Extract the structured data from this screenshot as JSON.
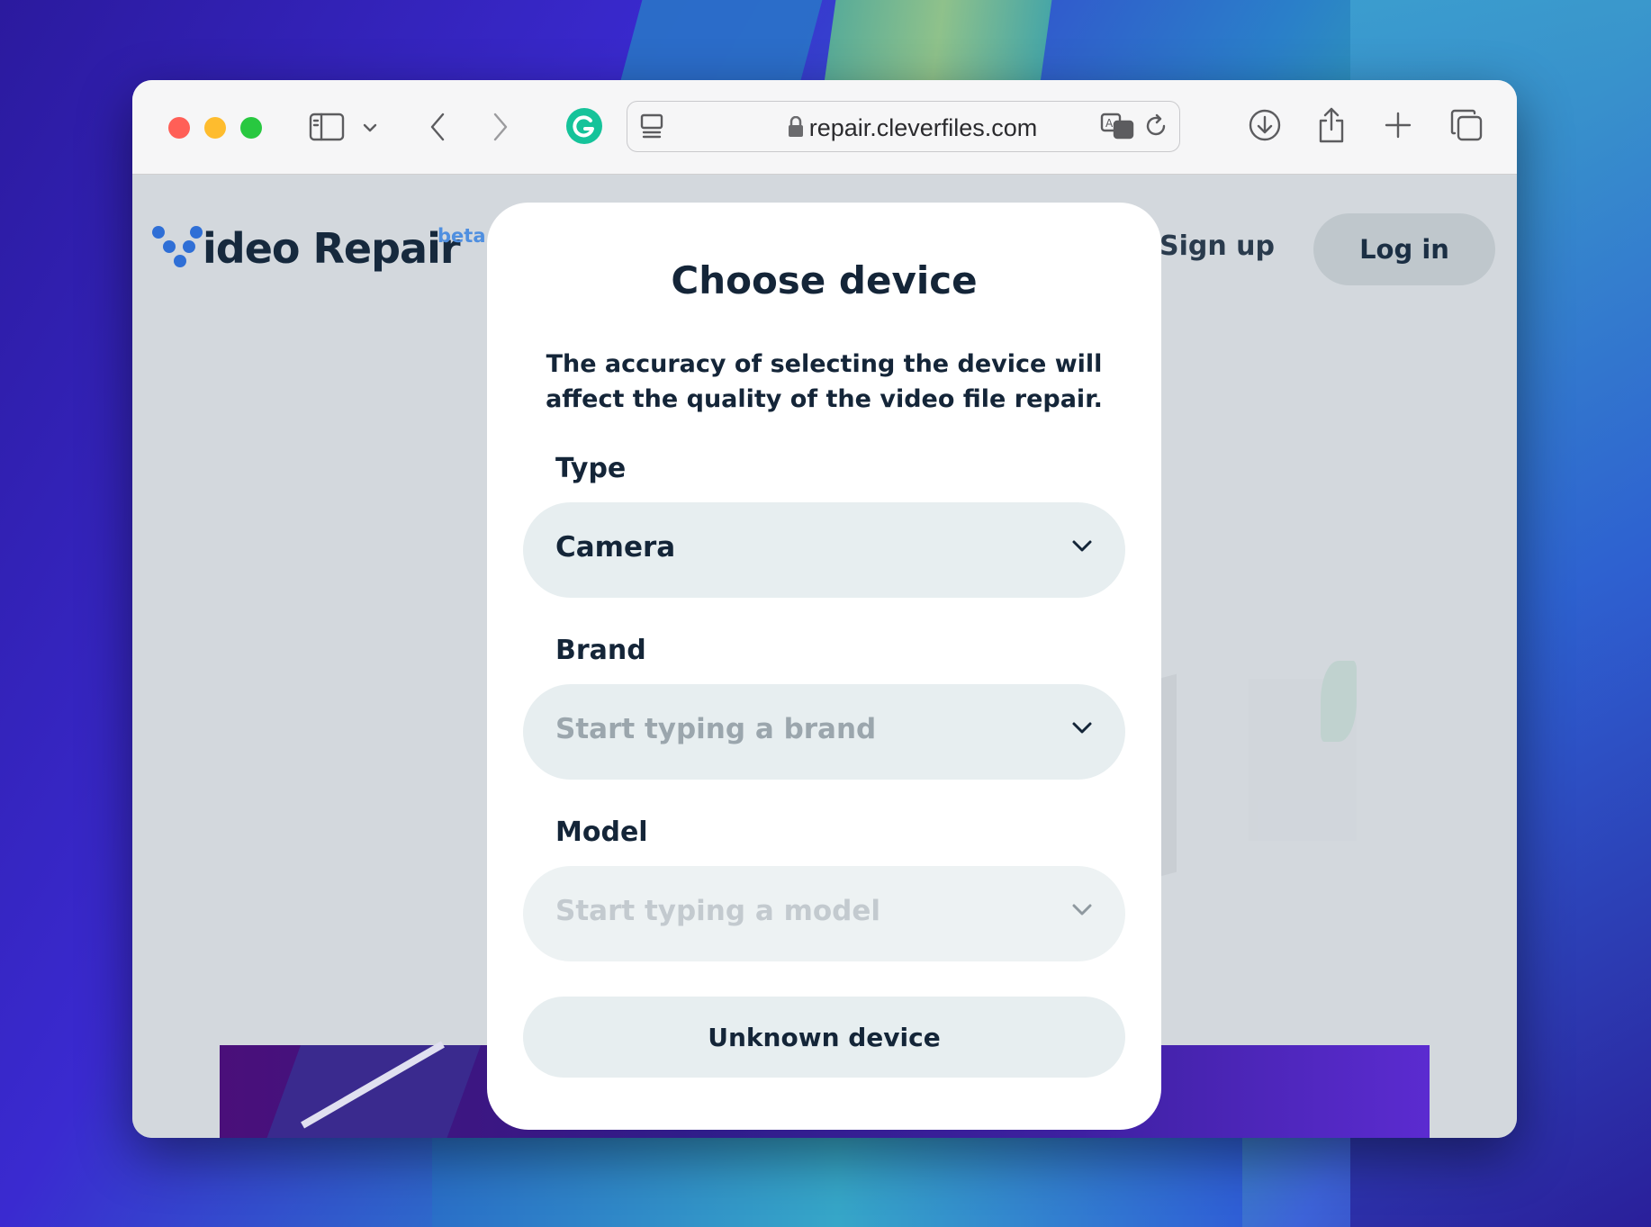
{
  "browser": {
    "address": "repair.cleverfiles.com"
  },
  "site": {
    "logo_text": "ideo Repair",
    "beta_label": "beta",
    "signup_label": "Sign up",
    "login_label": "Log in"
  },
  "modal": {
    "title": "Choose device",
    "description": "The accuracy of selecting the device will affect the quality of the video file repair.",
    "type_label": "Type",
    "type_value": "Camera",
    "brand_label": "Brand",
    "brand_placeholder": "Start typing a brand",
    "model_label": "Model",
    "model_placeholder": "Start typing a model",
    "unknown_label": "Unknown device"
  },
  "colors": {
    "primary_text": "#142538",
    "field_bg": "#e7eef0",
    "logo_dots": "#2f6fd6",
    "close": "#ff5f57",
    "minimize": "#febc2e",
    "zoom": "#28c840",
    "grammarly": "#15c39a"
  }
}
